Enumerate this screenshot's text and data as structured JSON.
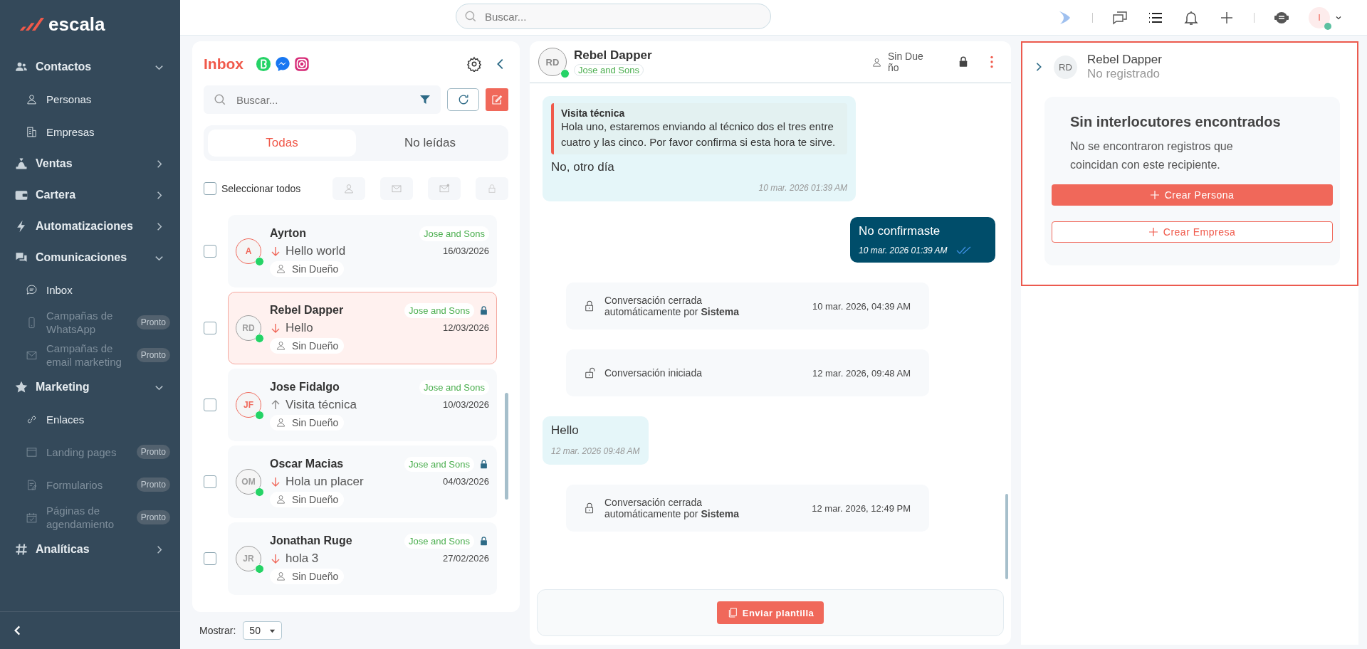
{
  "logo": "escala",
  "topbar": {
    "search_placeholder": "Buscar...",
    "user_initial": "I"
  },
  "sidebar": {
    "items": [
      {
        "label": "Contactos",
        "expanded": true,
        "children": [
          {
            "label": "Personas",
            "disabled": false
          },
          {
            "label": "Empresas",
            "disabled": false
          }
        ]
      },
      {
        "label": "Ventas",
        "expanded": false
      },
      {
        "label": "Cartera",
        "expanded": false
      },
      {
        "label": "Automatizaciones",
        "expanded": false
      },
      {
        "label": "Comunicaciones",
        "expanded": true,
        "children": [
          {
            "label": "Inbox",
            "disabled": false
          },
          {
            "label": "Campañas de WhatsApp",
            "disabled": true,
            "badge": "Pronto"
          },
          {
            "label": "Campañas de email marketing",
            "disabled": true,
            "badge": "Pronto"
          }
        ]
      },
      {
        "label": "Marketing",
        "expanded": true,
        "children": [
          {
            "label": "Enlaces",
            "disabled": false
          },
          {
            "label": "Landing pages",
            "disabled": true,
            "badge": "Pronto"
          },
          {
            "label": "Formularios",
            "disabled": true,
            "badge": "Pronto"
          },
          {
            "label": "Páginas de agendamiento",
            "disabled": true,
            "badge": "Pronto"
          }
        ]
      },
      {
        "label": "Analíticas",
        "expanded": false
      }
    ]
  },
  "inbox": {
    "title": "Inbox",
    "search_placeholder": "Buscar...",
    "tabs": [
      {
        "label": "Todas",
        "selected": true
      },
      {
        "label": "No leídas",
        "selected": false
      }
    ],
    "select_all": {
      "label": "Seleccionar todos",
      "checked": false
    },
    "conversations": [
      {
        "name": "Ayrton",
        "initials": "A",
        "color": "#f0685a",
        "incoming": true,
        "preview": "Hello world",
        "date": "16/03/2026",
        "tag": "Jose and Sons",
        "locked": false,
        "owner": "Sin Dueño",
        "selected": false,
        "checked": false
      },
      {
        "name": "Rebel Dapper",
        "initials": "RD",
        "color": "#9e9e9e",
        "incoming": true,
        "preview": "Hello",
        "date": "12/03/2026",
        "tag": "Jose and Sons",
        "locked": true,
        "owner": "Sin Dueño",
        "selected": true,
        "checked": false
      },
      {
        "name": "Jose Fidalgo",
        "initials": "JF",
        "color": "#f0685a",
        "incoming": false,
        "preview": "Visita técnica",
        "date": "10/03/2026",
        "tag": "Jose and Sons",
        "locked": false,
        "owner": "Sin Dueño",
        "selected": false,
        "checked": false
      },
      {
        "name": "Oscar Macias",
        "initials": "OM",
        "color": "#9e9e9e",
        "incoming": true,
        "preview": "Hola un placer",
        "date": "04/03/2026",
        "tag": "Jose and Sons",
        "locked": true,
        "owner": "Sin Dueño",
        "selected": false,
        "checked": false
      },
      {
        "name": "Jonathan Ruge",
        "initials": "JR",
        "color": "#9e9e9e",
        "incoming": true,
        "preview": "hola 3",
        "date": "27/02/2026",
        "tag": "Jose and Sons",
        "locked": true,
        "owner": "Sin Dueño",
        "selected": false,
        "checked": false
      }
    ],
    "page_size": {
      "label": "Mostrar:",
      "value": "50"
    }
  },
  "chat": {
    "contact": {
      "name": "Rebel Dapper",
      "initials": "RD",
      "tag": "Jose and Sons",
      "owner": "Sin Due ño",
      "locked": true
    },
    "messages": [
      {
        "kind": "incoming",
        "quote_title": "Visita técnica",
        "quote_text": "Hola uno,  estaremos enviando al técnico dos el tres entre cuatro y las cinco. Por favor confirma si esta hora te sirve.",
        "text": "No, otro día",
        "time": "10 mar. 2026 01:39 AM"
      },
      {
        "kind": "outgoing",
        "text": "No confirmaste",
        "time": "10 mar. 2026 01:39 AM",
        "read": true
      },
      {
        "kind": "event",
        "locked": true,
        "text": "Conversación cerrada automáticamente por **Sistema**",
        "time": "10 mar. 2026, 04:39 AM"
      },
      {
        "kind": "event",
        "locked": false,
        "text": "Conversación iniciada",
        "time": "12 mar. 2026, 09:48 AM"
      },
      {
        "kind": "incoming",
        "text": "Hello",
        "time": "12 mar. 2026 09:48 AM"
      },
      {
        "kind": "event",
        "locked": true,
        "text": "Conversación cerrada automáticamente por **Sistema**",
        "time": "12 mar. 2026, 12:49 PM"
      }
    ],
    "template_button": "Enviar plantilla"
  },
  "contact_panel": {
    "initials": "RD",
    "name": "Rebel Dapper",
    "status": "No registrado",
    "empty_title": "Sin interlocutores encontrados",
    "empty_text": "No se encontraron registros que coincidan con este recipiente.",
    "buttons": [
      {
        "label": "Crear Persona",
        "kind": "primary"
      },
      {
        "label": "Crear Empresa",
        "kind": "outline"
      }
    ]
  }
}
